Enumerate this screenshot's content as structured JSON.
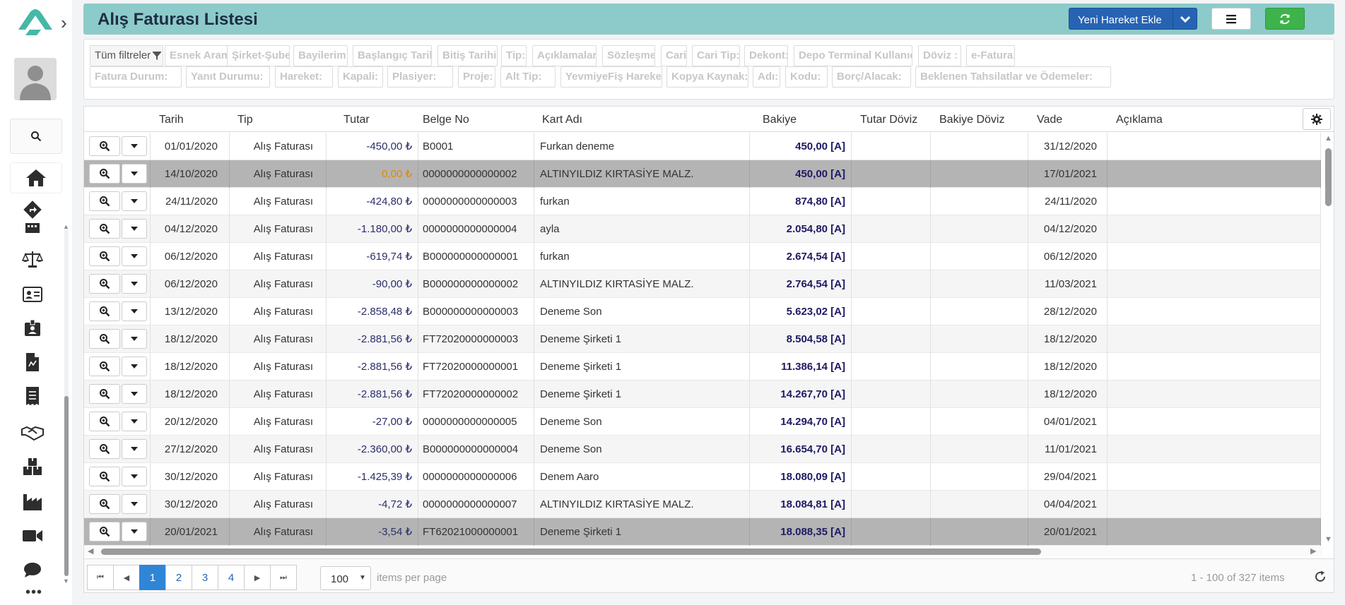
{
  "header": {
    "title": "Alış Faturası Listesi",
    "new_button": "Yeni Hareket Ekle"
  },
  "filters": {
    "all_label": "Tüm filtreler",
    "row1": [
      "Esnek Arama:",
      "Şirket-Şube:",
      "Bayilerim:",
      "Başlangıç Tarihi:",
      "Bitiş Tarihi:",
      "Tip:",
      "Açıklamalar:",
      "Sözleşme:",
      "Cari:",
      "Cari Tip:",
      "Dekont:",
      "Depo Terminal Kullanıcı:",
      "Döviz :",
      "e-Fatura:"
    ],
    "row2": [
      "Fatura Durum:",
      "Yanıt Durumu:",
      "Hareket:",
      "Kapali:",
      "Plasiyer:",
      "Proje:",
      "Alt Tip:",
      "YevmiyeFiş Hareket:",
      "Kopya Kaynak:",
      "Adı:",
      "Kodu:",
      "Borç/Alacak:",
      "Beklenen Tahsilatlar ve Ödemeler:"
    ]
  },
  "columns": [
    "Tarih",
    "Tip",
    "Tutar",
    "Belge No",
    "Kart Adı",
    "Bakiye",
    "Tutar Döviz",
    "Bakiye Döviz",
    "Vade",
    "Açıklama"
  ],
  "rows": [
    {
      "tarih": "01/01/2020",
      "tip": "Alış Faturası",
      "tutar": "-450,00 ₺",
      "belge": "B0001",
      "kart": "Furkan deneme",
      "bakiye": "450,00 [A]",
      "vade": "31/12/2020"
    },
    {
      "tarih": "14/10/2020",
      "tip": "Alış Faturası",
      "tutar": "0,00 ₺",
      "belge": "0000000000000002",
      "kart": "ALTINYILDIZ KIRTASİYE MALZ.",
      "bakiye": "450,00 [A]",
      "vade": "17/01/2021"
    },
    {
      "tarih": "24/11/2020",
      "tip": "Alış Faturası",
      "tutar": "-424,80 ₺",
      "belge": "0000000000000003",
      "kart": "furkan",
      "bakiye": "874,80 [A]",
      "vade": "24/11/2020"
    },
    {
      "tarih": "04/12/2020",
      "tip": "Alış Faturası",
      "tutar": "-1.180,00 ₺",
      "belge": "0000000000000004",
      "kart": "ayla",
      "bakiye": "2.054,80 [A]",
      "vade": "04/12/2020"
    },
    {
      "tarih": "06/12/2020",
      "tip": "Alış Faturası",
      "tutar": "-619,74 ₺",
      "belge": "B000000000000001",
      "kart": "furkan",
      "bakiye": "2.674,54 [A]",
      "vade": "06/12/2020"
    },
    {
      "tarih": "06/12/2020",
      "tip": "Alış Faturası",
      "tutar": "-90,00 ₺",
      "belge": "B000000000000002",
      "kart": "ALTINYILDIZ KIRTASİYE MALZ.",
      "bakiye": "2.764,54 [A]",
      "vade": "11/03/2021"
    },
    {
      "tarih": "13/12/2020",
      "tip": "Alış Faturası",
      "tutar": "-2.858,48 ₺",
      "belge": "B000000000000003",
      "kart": "Deneme Son",
      "bakiye": "5.623,02 [A]",
      "vade": "28/12/2020"
    },
    {
      "tarih": "18/12/2020",
      "tip": "Alış Faturası",
      "tutar": "-2.881,56 ₺",
      "belge": "FT72020000000003",
      "kart": "Deneme Şirketi 1",
      "bakiye": "8.504,58 [A]",
      "vade": "18/12/2020"
    },
    {
      "tarih": "18/12/2020",
      "tip": "Alış Faturası",
      "tutar": "-2.881,56 ₺",
      "belge": "FT72020000000001",
      "kart": "Deneme Şirketi 1",
      "bakiye": "11.386,14 [A]",
      "vade": "18/12/2020"
    },
    {
      "tarih": "18/12/2020",
      "tip": "Alış Faturası",
      "tutar": "-2.881,56 ₺",
      "belge": "FT72020000000002",
      "kart": "Deneme Şirketi 1",
      "bakiye": "14.267,70 [A]",
      "vade": "18/12/2020"
    },
    {
      "tarih": "20/12/2020",
      "tip": "Alış Faturası",
      "tutar": "-27,00 ₺",
      "belge": "0000000000000005",
      "kart": "Deneme Son",
      "bakiye": "14.294,70 [A]",
      "vade": "04/01/2021"
    },
    {
      "tarih": "27/12/2020",
      "tip": "Alış Faturası",
      "tutar": "-2.360,00 ₺",
      "belge": "B000000000000004",
      "kart": "Deneme Son",
      "bakiye": "16.654,70 [A]",
      "vade": "11/01/2021"
    },
    {
      "tarih": "30/12/2020",
      "tip": "Alış Faturası",
      "tutar": "-1.425,39 ₺",
      "belge": "0000000000000006",
      "kart": "Denem Aaro",
      "bakiye": "18.080,09 [A]",
      "vade": "29/04/2021"
    },
    {
      "tarih": "30/12/2020",
      "tip": "Alış Faturası",
      "tutar": "-4,72 ₺",
      "belge": "0000000000000007",
      "kart": "ALTINYILDIZ KIRTASİYE MALZ.",
      "bakiye": "18.084,81 [A]",
      "vade": "04/04/2021"
    },
    {
      "tarih": "20/01/2021",
      "tip": "Alış Faturası",
      "tutar": "-3,54 ₺",
      "belge": "FT62021000000001",
      "kart": "Deneme Şirketi 1",
      "bakiye": "18.088,35 [A]",
      "vade": "20/01/2021"
    }
  ],
  "selected_rows": [
    1,
    14
  ],
  "zero_amount_rows": [
    1
  ],
  "pager": {
    "pages": [
      "1",
      "2",
      "3",
      "4"
    ],
    "current_page": "1",
    "per_page": "100",
    "items_per_page_label": "items per page",
    "count": "1 - 100 of 327 items"
  },
  "sidebar": {
    "icons": [
      "home-icon",
      "route-icon",
      "calculator-icon",
      "scale-icon",
      "id-card-icon",
      "badge-icon",
      "invoice-icon",
      "receipt-icon",
      "handshake-icon",
      "boxes-icon",
      "factory-icon",
      "video-icon",
      "chat-icon",
      "more-icon"
    ]
  },
  "colors": {
    "header_bg": "#8ccbc9",
    "primary_button": "#2763b3",
    "success_button": "#3eb24b",
    "selected_row": "#b4b4b4",
    "zero_amount": "#e08a00",
    "balance_text": "#1f1a63",
    "brand_logo": "#46b8a8"
  }
}
